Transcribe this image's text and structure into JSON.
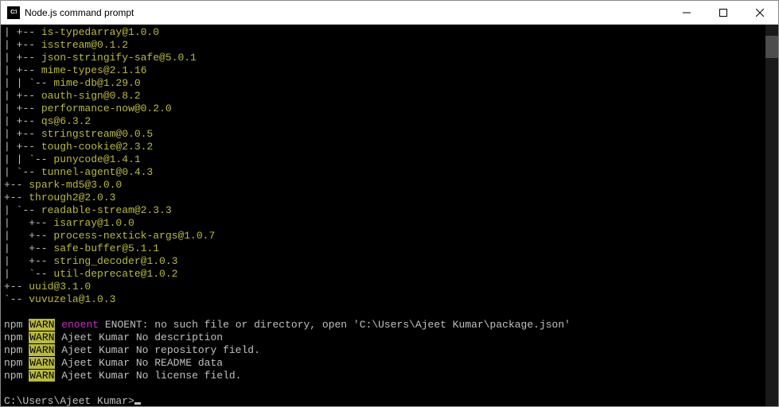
{
  "window": {
    "title": "Node.js command prompt",
    "icon_label": "C:\\"
  },
  "tree": [
    {
      "prefix": "| +-- ",
      "pkg": "is-typedarray@1.0.0"
    },
    {
      "prefix": "| +-- ",
      "pkg": "isstream@0.1.2"
    },
    {
      "prefix": "| +-- ",
      "pkg": "json-stringify-safe@5.0.1"
    },
    {
      "prefix": "| +-- ",
      "pkg": "mime-types@2.1.16"
    },
    {
      "prefix": "| | `-- ",
      "pkg": "mime-db@1.29.0"
    },
    {
      "prefix": "| +-- ",
      "pkg": "oauth-sign@0.8.2"
    },
    {
      "prefix": "| +-- ",
      "pkg": "performance-now@0.2.0"
    },
    {
      "prefix": "| +-- ",
      "pkg": "qs@6.3.2"
    },
    {
      "prefix": "| +-- ",
      "pkg": "stringstream@0.0.5"
    },
    {
      "prefix": "| +-- ",
      "pkg": "tough-cookie@2.3.2"
    },
    {
      "prefix": "| | `-- ",
      "pkg": "punycode@1.4.1"
    },
    {
      "prefix": "| `-- ",
      "pkg": "tunnel-agent@0.4.3"
    },
    {
      "prefix": "+-- ",
      "pkg": "spark-md5@3.0.0"
    },
    {
      "prefix": "+-- ",
      "pkg": "through2@2.0.3"
    },
    {
      "prefix": "| `-- ",
      "pkg": "readable-stream@2.3.3"
    },
    {
      "prefix": "|   +-- ",
      "pkg": "isarray@1.0.0"
    },
    {
      "prefix": "|   +-- ",
      "pkg": "process-nextick-args@1.0.7"
    },
    {
      "prefix": "|   +-- ",
      "pkg": "safe-buffer@5.1.1"
    },
    {
      "prefix": "|   +-- ",
      "pkg": "string_decoder@1.0.3"
    },
    {
      "prefix": "|   `-- ",
      "pkg": "util-deprecate@1.0.2"
    },
    {
      "prefix": "+-- ",
      "pkg": "uuid@3.1.0"
    },
    {
      "prefix": "`-- ",
      "pkg": "vuvuzela@1.0.3"
    }
  ],
  "warnings": [
    {
      "npm": "npm",
      "warn": "WARN",
      "code": "enoent",
      "rest": " ENOENT: no such file or directory, open 'C:\\Users\\Ajeet Kumar\\package.json'"
    },
    {
      "npm": "npm",
      "warn": "WARN",
      "code": "",
      "rest": " Ajeet Kumar No description"
    },
    {
      "npm": "npm",
      "warn": "WARN",
      "code": "",
      "rest": " Ajeet Kumar No repository field."
    },
    {
      "npm": "npm",
      "warn": "WARN",
      "code": "",
      "rest": " Ajeet Kumar No README data"
    },
    {
      "npm": "npm",
      "warn": "WARN",
      "code": "",
      "rest": " Ajeet Kumar No license field."
    }
  ],
  "prompt": "C:\\Users\\Ajeet Kumar>"
}
